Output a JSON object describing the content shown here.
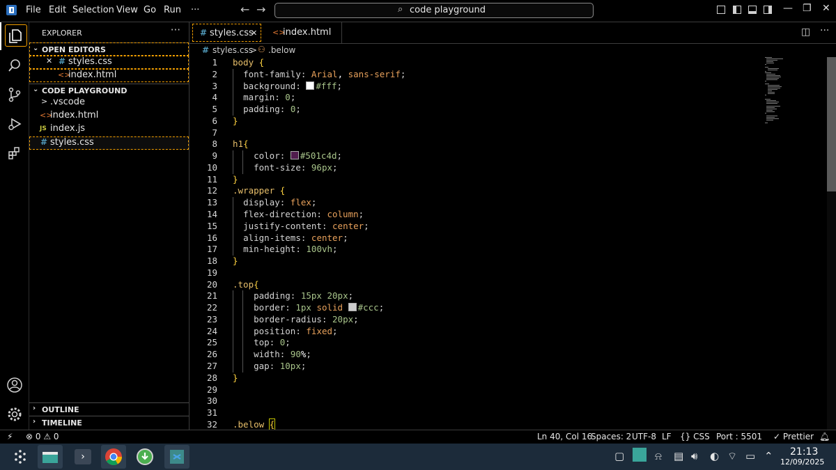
{
  "titlebar": {
    "menus": [
      "File",
      "Edit",
      "Selection",
      "View",
      "Go",
      "Run",
      "···"
    ],
    "search_text": "code playground"
  },
  "explorer": {
    "title": "EXPLORER",
    "more": "···",
    "open_editors": {
      "label": "OPEN EDITORS",
      "items": [
        {
          "icon": "#",
          "name": "styles.css",
          "close": "✕"
        },
        {
          "icon": "<>",
          "name": "index.html"
        }
      ]
    },
    "project": {
      "label": "CODE PLAYGROUND",
      "items": [
        {
          "icon": ">",
          "name": ".vscode"
        },
        {
          "icon": "<>",
          "name": "index.html"
        },
        {
          "icon": "JS",
          "name": "index.js"
        },
        {
          "icon": "#",
          "name": "styles.css"
        }
      ]
    },
    "outline_label": "OUTLINE",
    "timeline_label": "TIMELINE"
  },
  "tabs": [
    {
      "icon": "#",
      "label": "styles.css",
      "close": "✕"
    },
    {
      "icon": "<>",
      "label": "index.html"
    }
  ],
  "breadcrumb": {
    "file": "styles.css",
    "separator": ">",
    "symbol": ".below"
  },
  "code_lines": [
    "body {",
    "  font-family: Arial, sans-serif;",
    "  background: #fff;",
    "  margin: 0;",
    "  padding: 0;",
    "}",
    "",
    "h1{",
    "    color: #501c4d;",
    "    font-size: 96px;",
    "}",
    ".wrapper {",
    "  display: flex;",
    "  flex-direction: column;",
    "  justify-content: center;",
    "  align-items: center;",
    "  min-height: 100vh;",
    "}",
    "",
    ".top{",
    "    padding: 15px 20px;",
    "    border: 1px solid #ccc;",
    "    border-radius: 20px;",
    "    position: fixed;",
    "    top: 0;",
    "    width: 90%;",
    "    gap: 10px;",
    "}",
    "",
    "",
    "",
    ".below {"
  ],
  "statusbar": {
    "remote": "⚡",
    "problems": "⊗ 0 ⚠ 0",
    "position": "Ln 40, Col 16",
    "spaces": "Spaces: 2",
    "encoding": "UTF-8",
    "eol": "LF",
    "language": "{} CSS",
    "port": "Port : 5501",
    "prettier": "✓ Prettier"
  },
  "taskbar": {
    "time": "21:13",
    "date": "12/09/2025"
  },
  "colors": {
    "accent_outline": "#f4a000",
    "css_icon": "#519aba",
    "html_icon": "#e37933",
    "swatch_purple": "#501c4d"
  }
}
